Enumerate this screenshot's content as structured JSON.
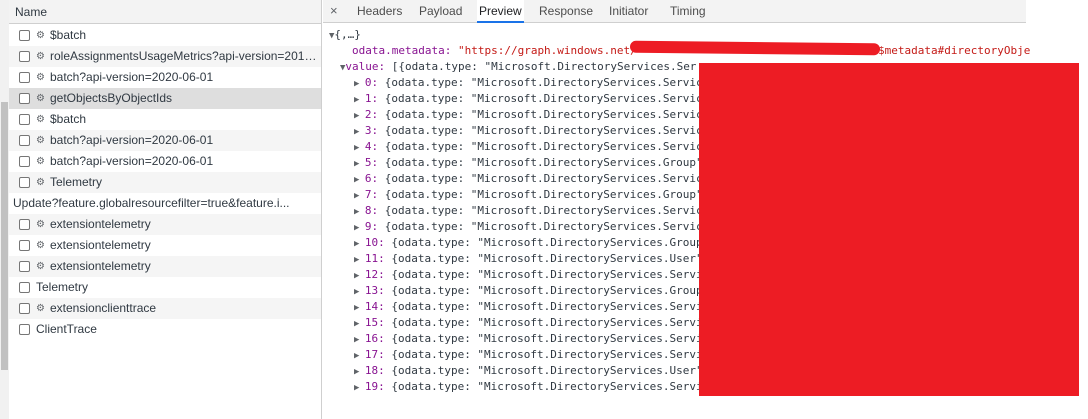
{
  "left_panel": {
    "column_header": "Name",
    "requests": [
      {
        "label": "$batch",
        "gear": true
      },
      {
        "label": "roleAssignmentsUsageMetrics?api-version=2019...",
        "gear": true
      },
      {
        "label": "batch?api-version=2020-06-01",
        "gear": true
      },
      {
        "label": "getObjectsByObjectIds",
        "gear": true,
        "selected": true
      },
      {
        "label": "$batch",
        "gear": true
      },
      {
        "label": "batch?api-version=2020-06-01",
        "gear": true
      },
      {
        "label": "batch?api-version=2020-06-01",
        "gear": true
      },
      {
        "label": "Telemetry",
        "gear": true
      },
      {
        "label": "Update?feature.globalresourcefilter=true&feature.i...",
        "gear": false,
        "checkbox": false
      },
      {
        "label": "extensiontelemetry",
        "gear": true
      },
      {
        "label": "extensiontelemetry",
        "gear": true
      },
      {
        "label": "extensiontelemetry",
        "gear": true
      },
      {
        "label": "Telemetry",
        "gear": false
      },
      {
        "label": "extensionclienttrace",
        "gear": true
      },
      {
        "label": "ClientTrace",
        "gear": false
      }
    ]
  },
  "tabs": {
    "close_glyph": "×",
    "items": [
      "Headers",
      "Payload",
      "Preview",
      "Response",
      "Initiator",
      "Timing"
    ],
    "active": "Preview"
  },
  "preview": {
    "root": "{,…}",
    "metadata_key": "odata.metadata:",
    "metadata_value_start": "\"https://graph.windows.net/",
    "metadata_value_end": "$metadata#directoryObje",
    "value_key": "value:",
    "value_summary": "[{odata.type: \"Microsoft.DirectoryServices.Ser",
    "items": [
      {
        "index": "0:",
        "text": "{odata.type: \"Microsoft.DirectoryServices.Servic"
      },
      {
        "index": "1:",
        "text": "{odata.type: \"Microsoft.DirectoryServices.Servic"
      },
      {
        "index": "2:",
        "text": "{odata.type: \"Microsoft.DirectoryServices.Servic"
      },
      {
        "index": "3:",
        "text": "{odata.type: \"Microsoft.DirectoryServices.Servic"
      },
      {
        "index": "4:",
        "text": "{odata.type: \"Microsoft.DirectoryServices.Servic"
      },
      {
        "index": "5:",
        "text": "{odata.type: \"Microsoft.DirectoryServices.Group\""
      },
      {
        "index": "6:",
        "text": "{odata.type: \"Microsoft.DirectoryServices.Servic"
      },
      {
        "index": "7:",
        "text": "{odata.type: \"Microsoft.DirectoryServices.Group\""
      },
      {
        "index": "8:",
        "text": "{odata.type: \"Microsoft.DirectoryServices.Servic"
      },
      {
        "index": "9:",
        "text": "{odata.type: \"Microsoft.DirectoryServices.Servic"
      },
      {
        "index": "10:",
        "text": "{odata.type: \"Microsoft.DirectoryServices.Group"
      },
      {
        "index": "11:",
        "text": "{odata.type: \"Microsoft.DirectoryServices.User\""
      },
      {
        "index": "12:",
        "text": "{odata.type: \"Microsoft.DirectoryServices.Servi"
      },
      {
        "index": "13:",
        "text": "{odata.type: \"Microsoft.DirectoryServices.Group"
      },
      {
        "index": "14:",
        "text": "{odata.type: \"Microsoft.DirectoryServices.Servi"
      },
      {
        "index": "15:",
        "text": "{odata.type: \"Microsoft.DirectoryServices.Servi"
      },
      {
        "index": "16:",
        "text": "{odata.type: \"Microsoft.DirectoryServices.Servi"
      },
      {
        "index": "17:",
        "text": "{odata.type: \"Microsoft.DirectoryServices.Servi"
      },
      {
        "index": "18:",
        "text": "{odata.type: \"Microsoft.DirectoryServices.User\""
      },
      {
        "index": "19:",
        "text": "{odata.type: \"Microsoft.DirectoryServices.Servi"
      }
    ]
  },
  "colors": {
    "accent": "#1a73e8",
    "redaction": "#ed1c24",
    "key": "#881391",
    "string": "#c41a16"
  }
}
